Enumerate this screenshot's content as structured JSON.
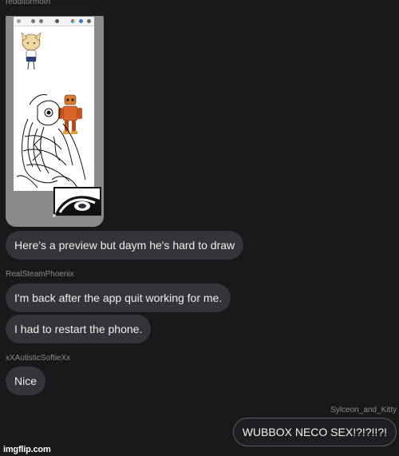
{
  "messages": [
    {
      "username": "redditormoth",
      "has_image": true,
      "text": "Here's a preview but daym he's hard to draw"
    },
    {
      "username": "RealSteamPhoenix",
      "texts": [
        "I'm back after the app quit working for me.",
        "I had to restart the phone."
      ]
    },
    {
      "username": "xXAutisticSoftieXx",
      "text": "Nice"
    },
    {
      "username": "Sylceon_and_Kitty",
      "text": "WUBBOX NECO SEX!?!?!!?!",
      "outgoing": true
    }
  ],
  "watermark": "imgflip.com",
  "colors": {
    "background": "#18191b",
    "bubble": "#34353a",
    "outgoing_border": "#5b5e66",
    "username": "#8c8c8c"
  }
}
